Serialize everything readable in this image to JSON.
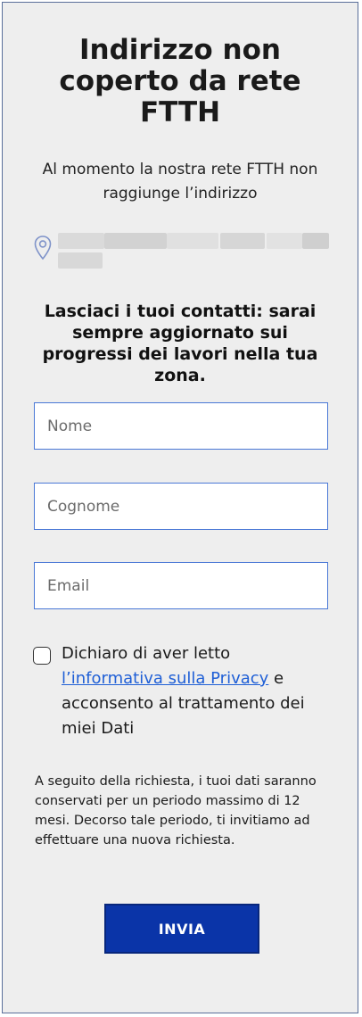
{
  "header": {
    "title": "Indirizzo non coperto da rete FTTH",
    "subtitle": "Al momento la nostra rete FTTH non raggiunge l’indirizzo"
  },
  "address": {
    "icon": "location-pin-icon"
  },
  "form": {
    "prompt": "Lasciaci i tuoi contatti: sarai sempre aggiornato sui progressi dei lavori nella tua zona.",
    "first_name_placeholder": "Nome",
    "last_name_placeholder": "Cognome",
    "email_placeholder": "Email",
    "consent_prefix": "Dichiaro di aver letto ",
    "consent_link": "l’informativa sulla Privacy",
    "consent_suffix": " e acconsento al trattamento dei miei Dati",
    "notice": "A seguito della richiesta, i tuoi dati saranno conservati per un periodo massimo di 12 mesi. Decorso tale periodo, ti invitiamo ad effettuare una nuova richiesta.",
    "submit_label": "INVIA"
  },
  "colors": {
    "panel_background": "#eeeeee",
    "field_border": "#4a78d6",
    "link": "#1f5fd6",
    "button_background": "#0a34a8",
    "pin_icon": "#7f93c9"
  }
}
